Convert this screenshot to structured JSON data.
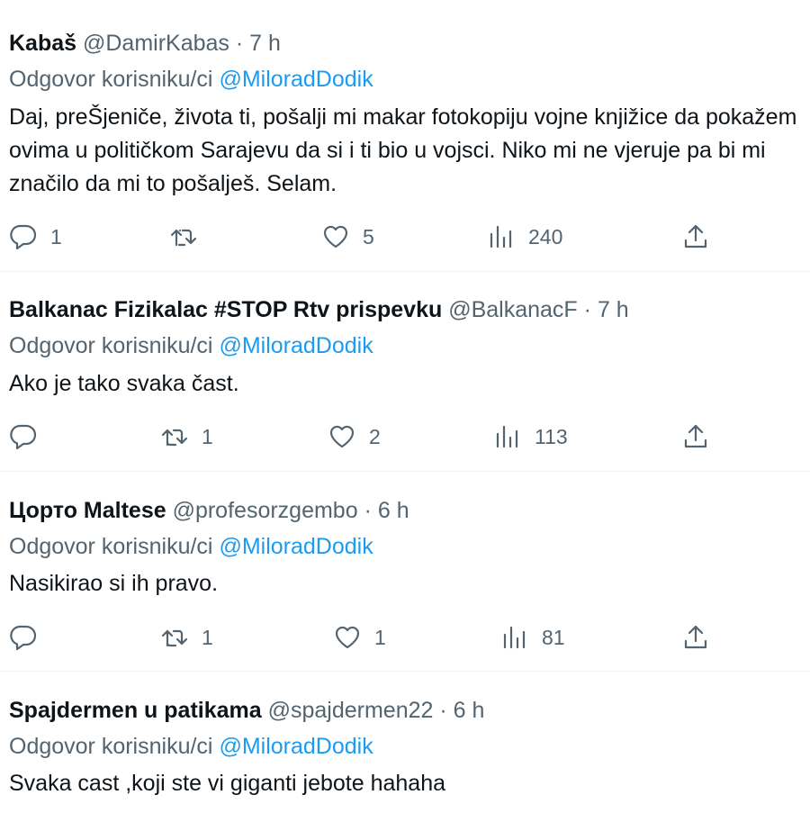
{
  "reply_prefix": "Odgovor korisniku/ci",
  "tweets": [
    {
      "name": "Kabaš",
      "handle": "@DamirKabas",
      "sep": "·",
      "time": "7 h",
      "reply_to": "@MiloradDodik",
      "text": "Daj, preŠjeniče, života ti, pošalji mi makar fotokopiju vojne knjižice da pokažem ovima u političkom Sarajevu da si i ti bio u vojsci. Niko mi ne vjeruje pa bi mi značilo da mi to pošalješ. Selam.",
      "replies": "1",
      "retweets": "",
      "likes": "5",
      "views": "240"
    },
    {
      "name": "Balkanac Fizikalac #STOP Rtv prispevku",
      "handle": "@BalkanacF",
      "sep": "·",
      "time": "7 h",
      "reply_to": "@MiloradDodik",
      "text": "Ako je tako svaka čast.",
      "replies": "",
      "retweets": "1",
      "likes": "2",
      "views": "113"
    },
    {
      "name": "Цорто Maltese",
      "handle": "@profesorzgembo",
      "sep": "·",
      "time": "6 h",
      "reply_to": "@MiloradDodik",
      "text": "Nasikirao si ih pravo.",
      "replies": "",
      "retweets": "1",
      "likes": "1",
      "views": "81"
    },
    {
      "name": "Spajdermen u patikama",
      "handle": "@spajdermen22",
      "sep": "·",
      "time": "6 h",
      "reply_to": "@MiloradDodik",
      "text": "Svaka cast ,koji ste vi giganti jebote hahaha"
    }
  ],
  "icons": [
    "reply-icon",
    "retweet-icon",
    "like-icon",
    "views-icon",
    "share-icon"
  ],
  "colors": {
    "text": "#0f1419",
    "muted": "#536471",
    "mention": "#1d9bf0",
    "divider": "#eff3f4"
  }
}
